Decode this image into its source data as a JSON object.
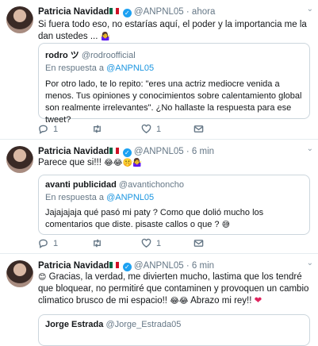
{
  "tweets": [
    {
      "name": "Patricia Navidad",
      "handle": "@ANPNL05",
      "time": "· ahora",
      "text": "Si fuera todo eso, no estarías aquí, el poder y la importancia me la dan ustedes ...",
      "text_emoji": "🤷‍♀️",
      "quote": {
        "name": "rodro ツ",
        "handle": "@rodroofficial",
        "reply_prefix": "En respuesta a",
        "reply_to": "@ANPNL05",
        "body": "Por otro lado, te lo repito: \"eres una actriz mediocre venida a menos. Tus opiniones y conocimientos sobre calentamiento global son realmente irrelevantes\". ¿No hallaste la respuesta para ese tweet?"
      },
      "replies": "1",
      "retweets": "",
      "likes": "1"
    },
    {
      "name": "Patricia Navidad",
      "handle": "@ANPNL05",
      "time": "· 6 min",
      "text": "Parece que si!!!",
      "text_emoji": "😂😂🤫🤷‍♀️",
      "quote": {
        "name": "avanti publicidad",
        "handle": "@avantichoncho",
        "reply_prefix": "En respuesta a",
        "reply_to": "@ANPNL05",
        "body": "Jajajajaja qué pasó mi paty ? Como que dolió mucho los comentarios que diste. pisaste callos o que ?",
        "body_emoji": "😅"
      },
      "replies": "1",
      "retweets": "",
      "likes": "1"
    },
    {
      "name": "Patricia Navidad",
      "handle": "@ANPNL05",
      "time": "· 6 min",
      "text_lead_emoji": "😊",
      "text": "Gracias, la verdad, me divierten mucho, lastima que los tendré que bloquear, no permitiré que contaminen y provoquen un cambio climatico brusco de mi espacio!!",
      "text_mid_emoji": "😂😂",
      "text_tail": "Abrazo mi rey!!",
      "text_heart": "❤",
      "quote": {
        "name": "Jorge Estrada",
        "handle": "@Jorge_Estrada05"
      }
    }
  ],
  "icons": {
    "verified": "✓",
    "chevron": "⌄"
  },
  "colors": {
    "accent": "#1da1f2",
    "link": "#1b95e0",
    "muted": "#657786",
    "heart": "#e0245e"
  }
}
